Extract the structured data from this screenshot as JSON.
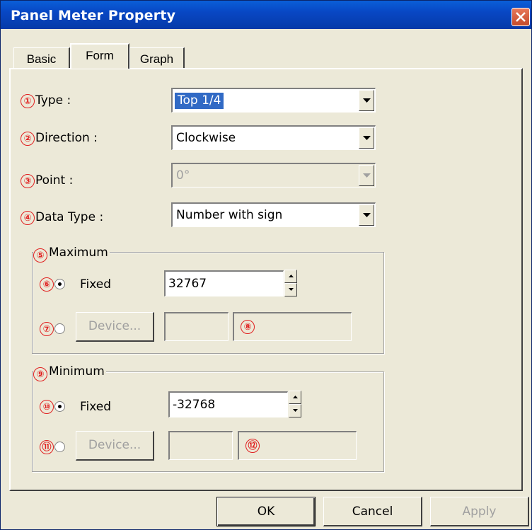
{
  "window": {
    "title": "Panel Meter Property"
  },
  "tabs": [
    {
      "label": "Basic"
    },
    {
      "label": "Form"
    },
    {
      "label": "Graph"
    }
  ],
  "form": {
    "type": {
      "marker": "①",
      "label": "Type :",
      "value": "Top 1/4"
    },
    "direction": {
      "marker": "②",
      "label": "Direction :",
      "value": "Clockwise"
    },
    "point": {
      "marker": "③",
      "label": "Point :",
      "value": "0°"
    },
    "data_type": {
      "marker": "④",
      "label": "Data Type :",
      "value": "Number with sign"
    }
  },
  "maximum": {
    "marker": "⑤",
    "title": "Maximum",
    "fixed_marker": "⑥",
    "fixed_label": "Fixed",
    "fixed_value": "32767",
    "device_marker": "⑦",
    "device_button": "Device...",
    "device_value_marker": "⑧"
  },
  "minimum": {
    "marker": "⑨",
    "title": "Minimum",
    "fixed_marker": "⑩",
    "fixed_label": "Fixed",
    "fixed_value": "-32768",
    "device_marker": "⑪",
    "device_button": "Device...",
    "device_value_marker": "⑫"
  },
  "buttons": {
    "ok": "OK",
    "cancel": "Cancel",
    "apply": "Apply"
  },
  "colors": {
    "titlebar": "#0847c4",
    "marker": "#e02020",
    "selection": "#316ac5"
  }
}
